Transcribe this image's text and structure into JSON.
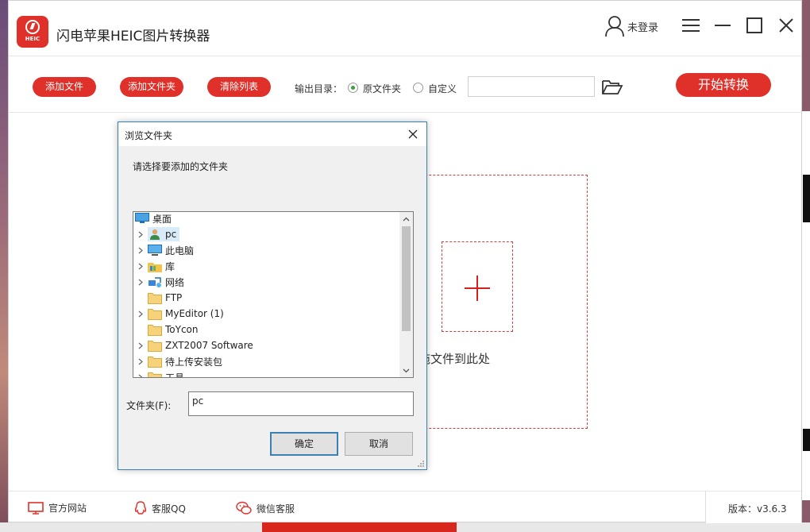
{
  "app": {
    "title": "闪电苹果HEIC图片转换器",
    "logo_text": "HEIC",
    "user_label": "未登录",
    "brand_color": "#e0302a"
  },
  "toolbar": {
    "add_file": "添加文件",
    "add_folder": "添加文件夹",
    "clear_list": "清除列表",
    "output_dir_label": "输出目录：",
    "opt_original": "原文件夹",
    "opt_custom": "自定义",
    "selected_output": "原文件夹",
    "custom_path_value": "",
    "start_button": "开始转换"
  },
  "dropzone": {
    "text": "拖文件到此处"
  },
  "footer": {
    "website": "官方网站",
    "qq": "客服QQ",
    "wechat": "微信客服",
    "version": "版本：v3.6.3"
  },
  "dialog": {
    "title": "浏览文件夹",
    "prompt": "请选择要添加的文件夹",
    "tree": [
      {
        "label": "桌面",
        "icon": "desktop-icon",
        "expandable": false,
        "indent": 0
      },
      {
        "label": "pc",
        "icon": "user-folder-icon",
        "expandable": true,
        "indent": 1,
        "selected": true
      },
      {
        "label": "此电脑",
        "icon": "computer-icon",
        "expandable": true,
        "indent": 1
      },
      {
        "label": "库",
        "icon": "library-icon",
        "expandable": true,
        "indent": 1
      },
      {
        "label": "网络",
        "icon": "network-icon",
        "expandable": true,
        "indent": 1
      },
      {
        "label": "FTP",
        "icon": "folder-icon",
        "expandable": false,
        "indent": 1
      },
      {
        "label": "MyEditor (1)",
        "icon": "folder-icon",
        "expandable": true,
        "indent": 1
      },
      {
        "label": "ToYcon",
        "icon": "folder-icon",
        "expandable": false,
        "indent": 1
      },
      {
        "label": "ZXT2007 Software",
        "icon": "folder-icon",
        "expandable": true,
        "indent": 1
      },
      {
        "label": "待上传安装包",
        "icon": "folder-icon",
        "expandable": true,
        "indent": 1
      },
      {
        "label": "工具",
        "icon": "folder-icon",
        "expandable": true,
        "indent": 1
      }
    ],
    "folder_label": "文件夹(F):",
    "folder_value": "pc",
    "ok": "确定",
    "cancel": "取消"
  }
}
